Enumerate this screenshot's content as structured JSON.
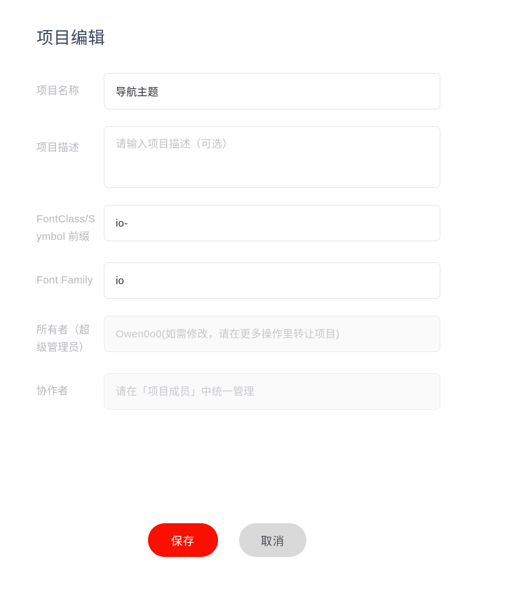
{
  "page": {
    "title": "项目编辑"
  },
  "colors": {
    "title": "#3b4559",
    "label": "#b7b7bd",
    "input_border": "#e6e6e8",
    "input_text": "#2d2d33",
    "placeholder": "#c2c2c8",
    "disabled_bg": "#fafafa",
    "primary": "#fa0f00",
    "default_button": "#d9d9d9"
  },
  "form": {
    "fields": [
      {
        "id": "project-name",
        "label": "项目名称",
        "value": "导航主题",
        "placeholder": "",
        "type": "text",
        "disabled": false
      },
      {
        "id": "project-description",
        "label": "项目描述",
        "value": "",
        "placeholder": "请输入项目描述（可选）",
        "type": "textarea",
        "disabled": false
      },
      {
        "id": "fontclass-prefix",
        "label": "FontClass/Symbol 前缀",
        "value": "io-",
        "placeholder": "",
        "type": "text",
        "disabled": false
      },
      {
        "id": "font-family",
        "label": "Font Family",
        "value": "io",
        "placeholder": "",
        "type": "text",
        "disabled": false
      },
      {
        "id": "owner",
        "label": "所有者（超级管理员）",
        "value": "",
        "placeholder": "Owen0o0(如需修改，请在更多操作里转让项目)",
        "type": "text",
        "disabled": true
      },
      {
        "id": "collaborators",
        "label": "协作者",
        "value": "",
        "placeholder": "请在「项目成员」中统一管理",
        "type": "text",
        "disabled": true
      }
    ]
  },
  "actions": {
    "save_label": "保存",
    "cancel_label": "取消"
  }
}
